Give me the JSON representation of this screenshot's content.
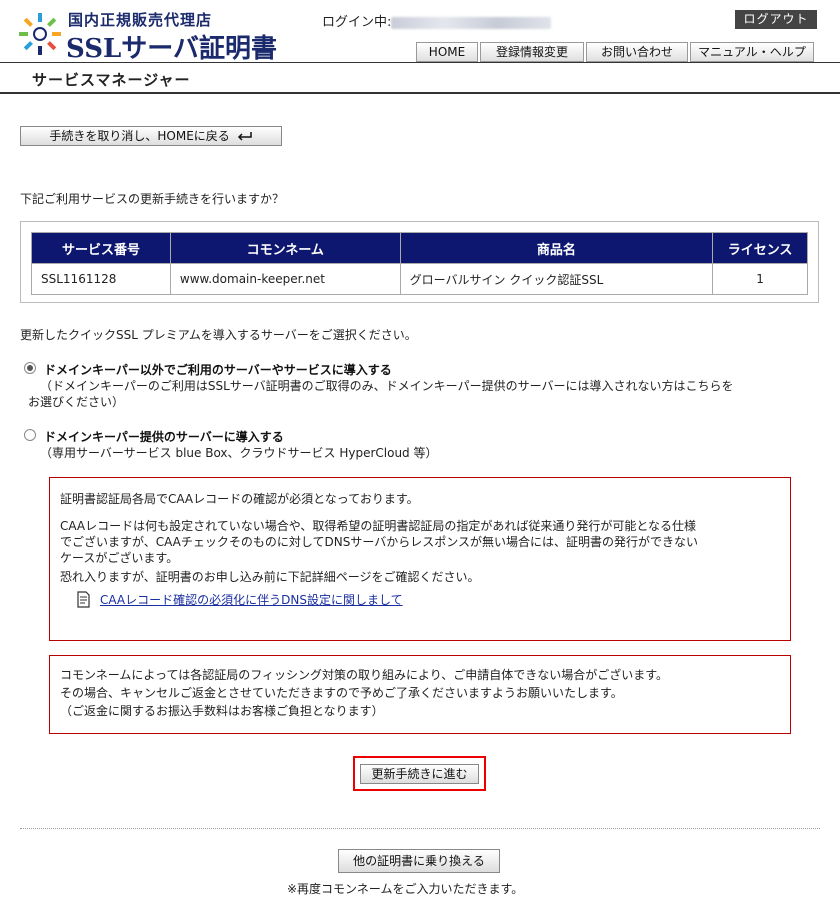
{
  "header": {
    "logo_sub": "国内正規販売代理店",
    "logo_main": "SSLサーバ証明書",
    "login_label": "ログイン中:",
    "logout_label": "ログアウト",
    "nav": [
      "HOME",
      "登録情報変更",
      "お問い合わせ",
      "マニュアル・ヘルプ"
    ]
  },
  "section_title": "サービスマネージャー",
  "cancel_button": "手続きを取り消し、HOMEに戻る",
  "question": "下記ご利用サービスの更新手続きを行いますか？",
  "table": {
    "headers": [
      "サービス番号",
      "コモンネーム",
      "商品名",
      "ライセンス"
    ],
    "rows": [
      [
        "SSL1161128",
        "www.domain-keeper.net",
        "グローバルサイン クイック認証SSL",
        "1"
      ]
    ]
  },
  "select_prompt": "更新したクイックSSL プレミアムを導入するサーバーをご選択ください。",
  "options": [
    {
      "label": "ドメインキーパー以外でご利用のサーバーやサービスに導入する",
      "note1": "（ドメインキーパーのご利用はSSLサーバ証明書のご取得のみ、ドメインキーパー提供のサーバーには導入されない方はこちらを",
      "note2": "お選びください）",
      "checked": true
    },
    {
      "label": "ドメインキーパー提供のサーバーに導入する",
      "note1": "（専用サーバーサービス blue Box、クラウドサービス HyperCloud 等）",
      "checked": false
    }
  ],
  "caa_notice": {
    "line1": "証明書認証局各局でCAAレコードの確認が必須となっております。",
    "line2": "CAAレコードは何も設定されていない場合や、取得希望の証明書認証局の指定があれば従来通り発行が可能となる仕様",
    "line3": "でございますが、CAAチェックそのものに対してDNSサーバからレスポンスが無い場合には、証明書の発行ができない",
    "line4": "ケースがございます。",
    "line5": "恐れ入りますが、証明書のお申し込み前に下記詳細ページをご確認ください。",
    "link": "CAAレコード確認の必須化に伴うDNS設定に関しまして"
  },
  "phishing_notice": {
    "line1": "コモンネームによっては各認証局のフィッシング対策の取り組みにより、ご申請自体できない場合がございます。",
    "line2": "その場合、キャンセルご返金とさせていただきますので予めご了承くださいますようお願いいたします。",
    "line3": "（ご返金に関するお振込手数料はお客様ご負担となります）"
  },
  "proceed_button": "更新手続きに進む",
  "switch_button": "他の証明書に乗り換える",
  "switch_note": "※再度コモンネームをご入力いただきます。",
  "colors": {
    "table_header": "#0d1770",
    "notice_border": "#bb0000",
    "highlight": "#ee0000"
  }
}
